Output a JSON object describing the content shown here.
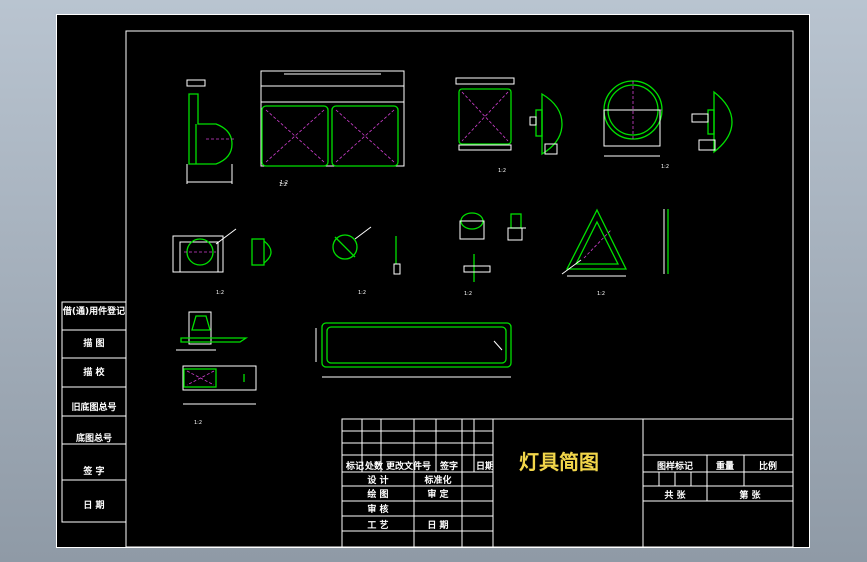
{
  "side_labels": [
    "借(通)用件登记",
    "描 图",
    "描 校",
    "旧底图总号",
    "底图总号",
    "签 字",
    "日 期"
  ],
  "title": "灯具简图",
  "left_block": {
    "header": [
      "标记",
      "处数",
      "更改文件号",
      "签字",
      "日期"
    ],
    "r1": [
      "设 计",
      "标准化"
    ],
    "r2": [
      "绘 图",
      "审 定"
    ],
    "r3": [
      "审 核"
    ],
    "r4": [
      "工 艺",
      "日 期"
    ]
  },
  "right_block": {
    "h1": [
      "图样标记",
      "重量",
      "比例"
    ],
    "h2": [
      "共 张",
      "第 张"
    ]
  },
  "view_labels": [
    "1:2",
    "1:2",
    "1:2",
    "1:2",
    "1:2",
    "1:2",
    "1:2",
    "1:2",
    "1:2"
  ]
}
